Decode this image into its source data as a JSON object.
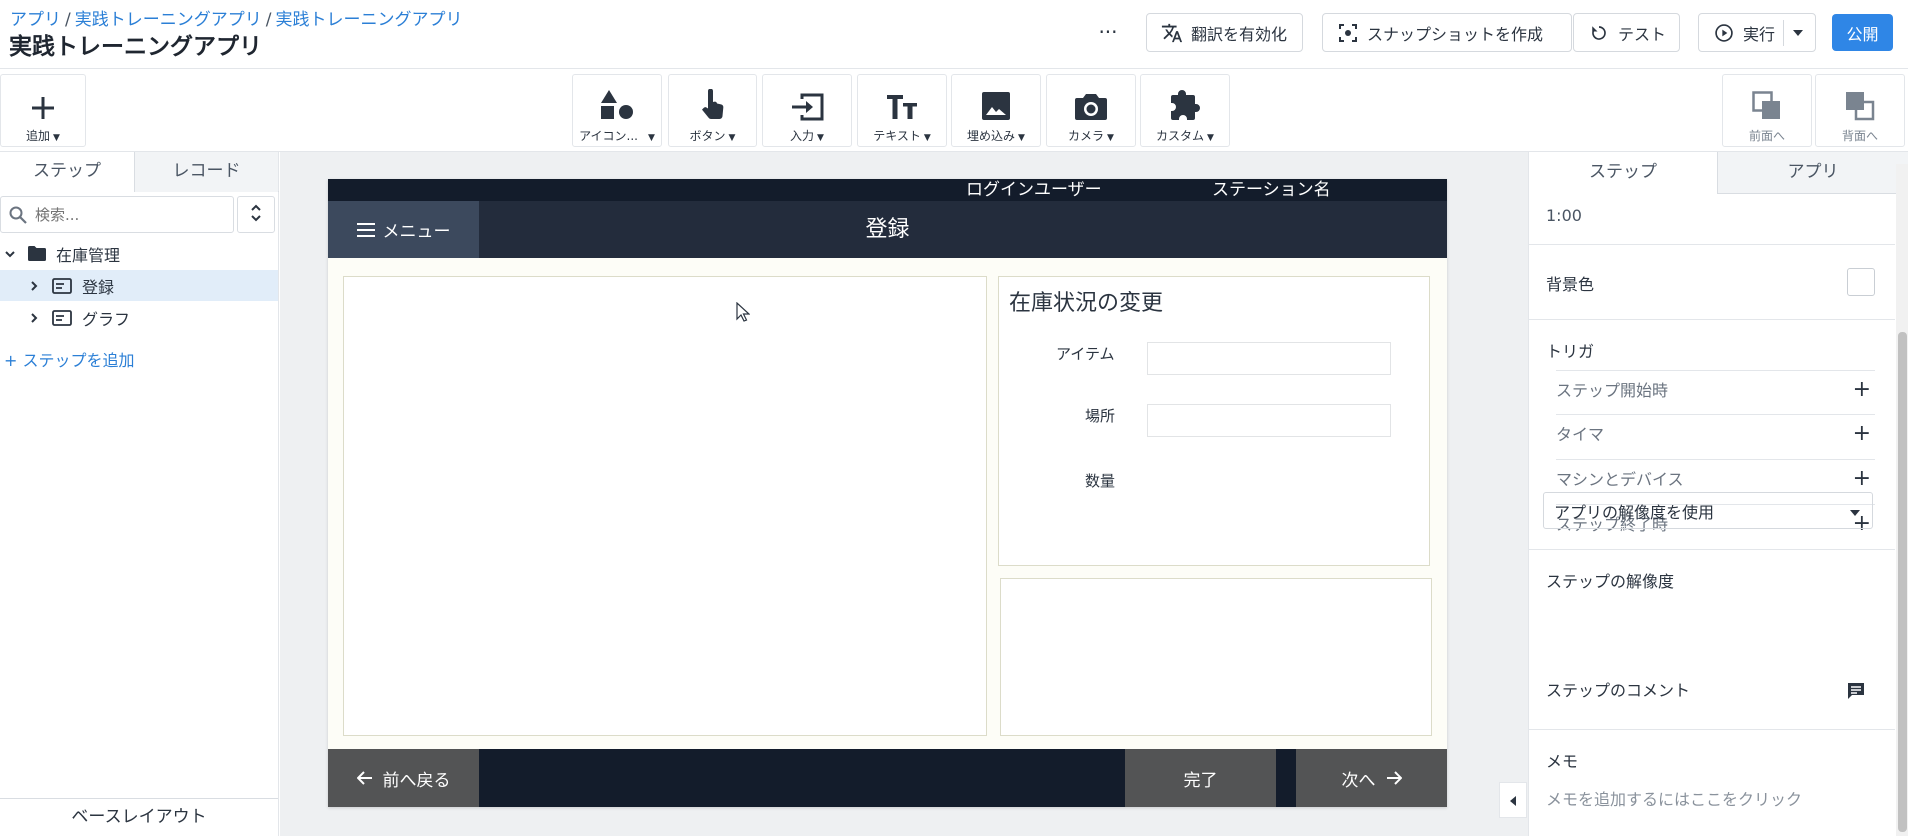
{
  "header": {
    "breadcrumb": [
      "アプリ",
      "実践トレーニングアプリ",
      "実践トレーニングアプリ"
    ],
    "title": "実践トレーニングアプリ",
    "more_label": "···",
    "translate_label": "翻訳を有効化",
    "snapshot_label": "スナップショットを作成",
    "test_label": "テスト",
    "run_label": "実行",
    "publish_label": "公開"
  },
  "toolbar": {
    "add_label": "追加",
    "widgets": [
      {
        "label": "アイコン..."
      },
      {
        "label": "ボタン"
      },
      {
        "label": "入力"
      },
      {
        "label": "テキスト"
      },
      {
        "label": "埋め込み"
      },
      {
        "label": "カメラ"
      },
      {
        "label": "カスタム"
      }
    ],
    "bring_front_label": "前面へ",
    "send_back_label": "背面へ"
  },
  "left_panel": {
    "tabs": [
      "ステップ",
      "レコード"
    ],
    "search_placeholder": "検索...",
    "tree": {
      "folder": "在庫管理",
      "steps": [
        "登録",
        "グラフ"
      ]
    },
    "add_step_label": "+ ステップを追加",
    "base_layout_label": "ベースレイアウト"
  },
  "canvas": {
    "status_user": "ログインユーザー",
    "status_station": "ステーション名",
    "menu_label": "メニュー",
    "screen_title": "登録",
    "form": {
      "title": "在庫状況の変更",
      "item_label": "アイテム",
      "location_label": "場所",
      "quantity_label": "数量"
    },
    "back_label": "前へ戻る",
    "complete_label": "完了",
    "next_label": "次へ"
  },
  "right_panel": {
    "tabs": [
      "ステップ",
      "アプリ"
    ],
    "duration": "1:00",
    "bg_color_label": "背景色",
    "triggers_label": "トリガ",
    "triggers": [
      "ステップ開始時",
      "タイマ",
      "マシンとデバイス",
      "ステップ終了時"
    ],
    "resolution_label": "ステップの解像度",
    "resolution_value": "アプリの解像度を使用",
    "comment_label": "ステップのコメント",
    "memo_label": "メモ",
    "memo_placeholder": "メモを追加するにはここをクリック"
  },
  "colors": {
    "accent": "#2f86e6",
    "canvas_dark": "#131c2b",
    "titlebar": "#232c3c",
    "menu_button": "#3c495d",
    "nav_button": "#535455",
    "selected_row": "#e1edf9"
  }
}
